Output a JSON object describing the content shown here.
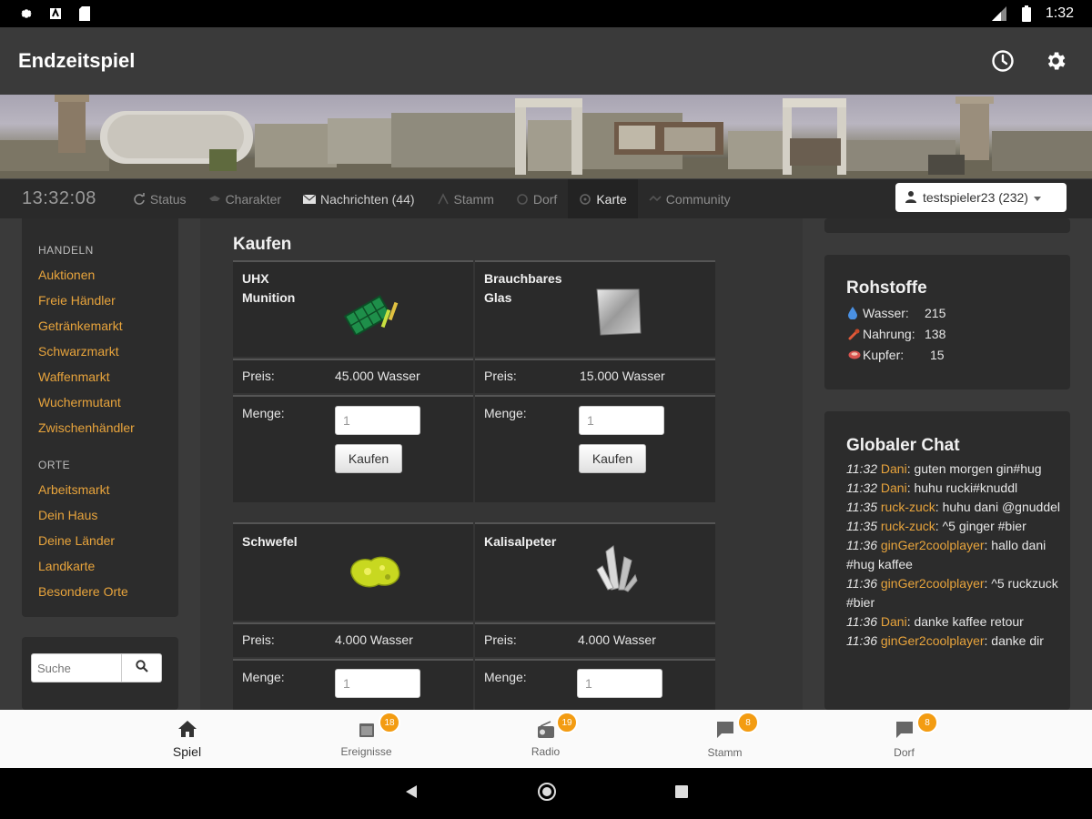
{
  "status_bar": {
    "time": "1:32"
  },
  "app": {
    "title": "Endzeitspiel"
  },
  "nav": {
    "clock": "13:32:08",
    "items": [
      {
        "label": "Status",
        "icon": "refresh-icon"
      },
      {
        "label": "Charakter",
        "icon": "character-icon"
      },
      {
        "label": "Nachrichten (44)",
        "icon": "envelope-icon"
      },
      {
        "label": "Stamm",
        "icon": "tribe-icon"
      },
      {
        "label": "Dorf",
        "icon": "village-icon"
      },
      {
        "label": "Karte",
        "icon": "map-icon"
      },
      {
        "label": "Community",
        "icon": "community-icon"
      }
    ],
    "user": "testspieler23 (232)"
  },
  "sidebar": {
    "sections": [
      {
        "label": "HANDELN",
        "links": [
          "Auktionen",
          "Freie Händler",
          "Getränkemarkt",
          "Schwarzmarkt",
          "Waffenmarkt",
          "Wuchermutant",
          "Zwischenhändler"
        ]
      },
      {
        "label": "ORTE",
        "links": [
          "Arbeitsmarkt",
          "Dein Haus",
          "Deine Länder",
          "Landkarte",
          "Besondere Orte"
        ]
      }
    ],
    "search_placeholder": "Suche"
  },
  "shop": {
    "title": "Kaufen",
    "price_label": "Preis:",
    "qty_label": "Menge:",
    "buy_label": "Kaufen",
    "qty_default": "1",
    "products": [
      {
        "name": "UHX Munition",
        "price": "45.000 Wasser",
        "icon": "ammo-icon"
      },
      {
        "name": "Brauchbares Glas",
        "price": "15.000 Wasser",
        "icon": "glass-icon"
      },
      {
        "name": "Schwefel",
        "price": "4.000 Wasser",
        "icon": "sulfur-icon"
      },
      {
        "name": "Kalisalpeter",
        "price": "4.000 Wasser",
        "icon": "crystal-icon"
      }
    ]
  },
  "resources": {
    "title": "Rohstoffe",
    "items": [
      {
        "label": "Wasser:",
        "value": "215",
        "color": "#4a90e2",
        "icon": "water-drop-icon"
      },
      {
        "label": "Nahrung:",
        "value": "138",
        "color": "#e05a3a",
        "icon": "food-icon"
      },
      {
        "label": "Kupfer:",
        "value": "15",
        "color": "#d9534f",
        "icon": "copper-icon"
      }
    ]
  },
  "chat": {
    "title": "Globaler Chat",
    "messages": [
      {
        "time": "11:32",
        "user": "Dani",
        "text": ": guten morgen gin#hug"
      },
      {
        "time": "11:32",
        "user": "Dani",
        "text": ": huhu rucki#knuddl"
      },
      {
        "time": "11:35",
        "user": "ruck-zuck",
        "text": ": huhu dani @gnuddel"
      },
      {
        "time": "11:35",
        "user": "ruck-zuck",
        "text": ": ^5 ginger #bier"
      },
      {
        "time": "11:36",
        "user": "ginGer2coolplayer",
        "text": ": hallo dani #hug kaffee"
      },
      {
        "time": "11:36",
        "user": "ginGer2coolplayer",
        "text": ": ^5 ruckzuck #bier"
      },
      {
        "time": "11:36",
        "user": "Dani",
        "text": ": danke kaffee retour"
      },
      {
        "time": "11:36",
        "user": "ginGer2coolplayer",
        "text": ": danke dir"
      }
    ]
  },
  "bottom_nav": {
    "items": [
      {
        "label": "Spiel",
        "badge": "",
        "icon": "home-icon"
      },
      {
        "label": "Ereignisse",
        "badge": "18",
        "icon": "events-icon"
      },
      {
        "label": "Radio",
        "badge": "19",
        "icon": "radio-icon"
      },
      {
        "label": "Stamm",
        "badge": "8",
        "icon": "chat-bubble-icon"
      },
      {
        "label": "Dorf",
        "badge": "8",
        "icon": "chat-bubble-icon"
      }
    ]
  },
  "colors": {
    "accent": "#e8a43c",
    "badge": "#f39c12",
    "appbar": "#3a3a3a"
  }
}
